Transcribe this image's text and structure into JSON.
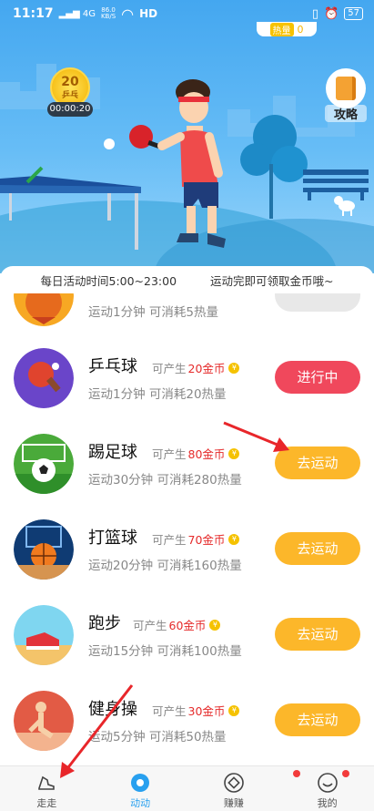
{
  "status": {
    "time": "11:17",
    "network": "4G",
    "speed_top": "86.0",
    "speed_unit": "KB/S",
    "hd": "HD",
    "battery": "57"
  },
  "hero": {
    "heat_label": "热量",
    "heat_value": "0",
    "badge_num": "20",
    "badge_name": "乒乓",
    "timer": "00:00:20",
    "guide_label": "攻略"
  },
  "notice": {
    "hours": "每日活动时间5:00~23:00",
    "tip": "运动完即可领取金币哦~"
  },
  "activities": [
    {
      "title": "",
      "produce": "",
      "gold": "",
      "desc": "运动1分钟 可消耗5热量",
      "button": "",
      "state": "disabled",
      "icon": "chicken-icon"
    },
    {
      "title": "乒乓球",
      "produce": "可产生",
      "gold": "20金币",
      "desc": "运动1分钟 可消耗20热量",
      "button": "进行中",
      "state": "active",
      "icon": "ping-pong-icon"
    },
    {
      "title": "踢足球",
      "produce": "可产生",
      "gold": "80金币",
      "desc": "运动30分钟 可消耗280热量",
      "button": "去运动",
      "state": "go",
      "icon": "soccer-icon"
    },
    {
      "title": "打篮球",
      "produce": "可产生",
      "gold": "70金币",
      "desc": "运动20分钟 可消耗160热量",
      "button": "去运动",
      "state": "go",
      "icon": "basketball-icon"
    },
    {
      "title": "跑步",
      "produce": "可产生",
      "gold": "60金币",
      "desc": "运动15分钟 可消耗100热量",
      "button": "去运动",
      "state": "go",
      "icon": "running-shoe-icon"
    },
    {
      "title": "健身操",
      "produce": "可产生",
      "gold": "30金币",
      "desc": "运动5分钟 可消耗50热量",
      "button": "去运动",
      "state": "go",
      "icon": "fitness-icon"
    }
  ],
  "tabbar": {
    "items": [
      {
        "label": "走走",
        "icon": "walk-shoe-icon"
      },
      {
        "label": "动动",
        "icon": "activity-icon"
      },
      {
        "label": "赚赚",
        "icon": "earn-icon"
      },
      {
        "label": "我的",
        "icon": "profile-icon"
      }
    ]
  },
  "colors": {
    "accent_blue": "#28a0ef",
    "go_button": "#fcb72a",
    "active_button": "#f0485c",
    "gold_text": "#e52b2b",
    "arrow": "#e8262a"
  }
}
